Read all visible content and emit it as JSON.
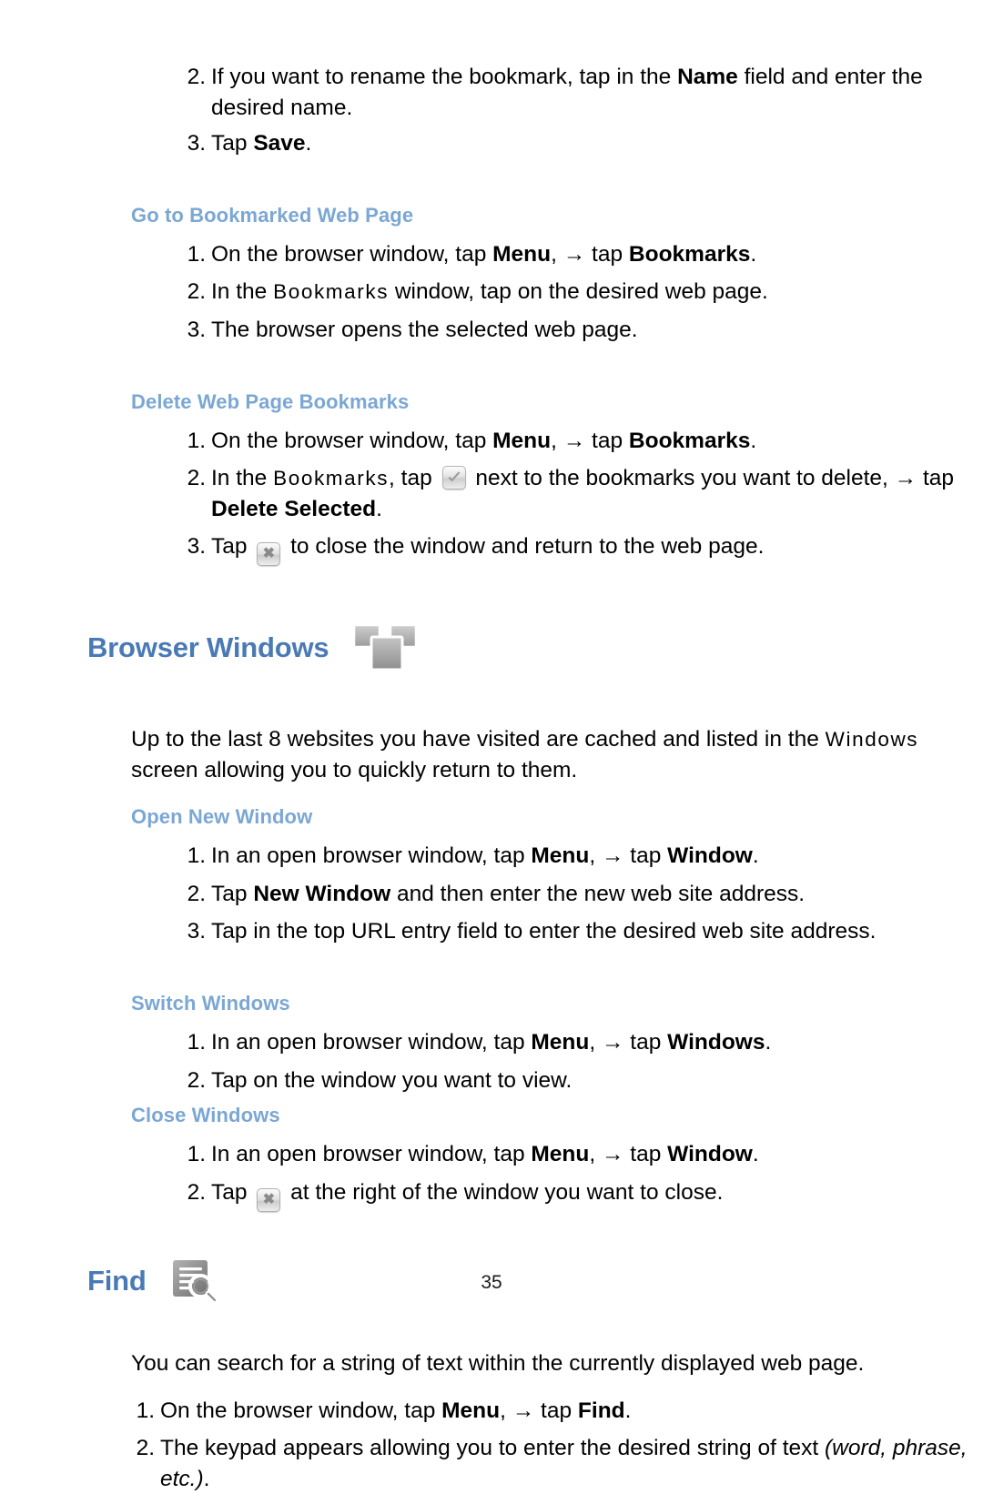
{
  "document": {
    "page_number": "35",
    "colors": {
      "heading_primary": "#4a7ab5",
      "heading_secondary": "#7ba7d4",
      "body_text": "#000000",
      "icon_gray": "#8a8a8a"
    }
  },
  "top_steps": {
    "items": [
      {
        "num": "2.",
        "text_before": "If you want to rename the bookmark, tap in the ",
        "bold": "Name",
        "text_after": " field and enter the desired name."
      },
      {
        "num": "3.",
        "text_before": "Tap ",
        "bold": "Save",
        "text_after": "."
      }
    ]
  },
  "section_goto_bookmarked": {
    "heading": "Go to Bookmarked Web Page",
    "steps": [
      {
        "num": "1.",
        "p1": "On the browser window, tap ",
        "b1": "Menu",
        "p2": ", ",
        "arrow": "→",
        "p3": " tap ",
        "b2": "Bookmarks",
        "p4": "."
      },
      {
        "num": "2.",
        "p1": "In the ",
        "mono": "Bookmarks",
        "p2": " window, tap on the desired web page."
      },
      {
        "num": "3.",
        "p1": "The browser opens the selected web page."
      }
    ]
  },
  "section_delete_bookmarks": {
    "heading": "Delete Web Page Bookmarks",
    "steps": [
      {
        "num": "1.",
        "p1": "On the browser window, tap ",
        "b1": "Menu",
        "p2": ", ",
        "arrow": "→",
        "p3": " tap ",
        "b2": "Bookmarks",
        "p4": "."
      },
      {
        "num": "2.",
        "p1": "In the ",
        "mono": "Bookmarks",
        "p2": ", tap ",
        "icon": "checkbox-icon",
        "p3": " next to the bookmarks you want to delete, ",
        "arrow": "→",
        "p4": " tap ",
        "b1": "Delete Selected",
        "p5": "."
      },
      {
        "num": "3.",
        "p1": "Tap ",
        "icon": "close-icon",
        "p2": " to close the window and return to the web page."
      }
    ]
  },
  "section_browser_windows": {
    "heading": "Browser Windows",
    "icon": "browser-windows-icon",
    "intro": {
      "p1": "Up to the last 8 websites you have visited are cached and listed in the ",
      "mono": "Windows",
      "p2": " screen allowing you to quickly return to them."
    },
    "open_new_window": {
      "heading": "Open New Window",
      "steps": [
        {
          "num": "1.",
          "p1": "In an open browser window, tap ",
          "b1": "Menu",
          "p2": ", ",
          "arrow": "→",
          "p3": " tap ",
          "b2": "Window",
          "p4": "."
        },
        {
          "num": "2.",
          "p1": "Tap ",
          "b1": "New Window",
          "p2": " and then enter the new web site address."
        },
        {
          "num": "3.",
          "p1": "Tap in the top URL entry field to enter the desired web site address."
        }
      ]
    },
    "switch_windows": {
      "heading": "Switch Windows",
      "steps": [
        {
          "num": "1.",
          "p1": "In an open browser window, tap ",
          "b1": "Menu",
          "p2": ", ",
          "arrow": "→",
          "p3": " tap ",
          "b2": "Windows",
          "p4": "."
        },
        {
          "num": "2.",
          "p1": "Tap on the window you want to view."
        }
      ]
    },
    "close_windows": {
      "heading": "Close Windows",
      "steps": [
        {
          "num": "1.",
          "p1": "In an open browser window, tap ",
          "b1": "Menu",
          "p2": ", ",
          "arrow": "→",
          "p3": " tap ",
          "b2": "Window",
          "p4": "."
        },
        {
          "num": "2.",
          "p1": "Tap ",
          "icon": "close-icon",
          "p2": " at the right of the window you want to close."
        }
      ]
    }
  },
  "section_find": {
    "heading": "Find",
    "icon": "find-icon",
    "intro": "You can search for a string of text within the currently displayed web page.",
    "steps": [
      {
        "num": "1.",
        "p1": "On the browser window, tap ",
        "b1": "Menu",
        "p2": ", ",
        "arrow": "→",
        "p3": " tap ",
        "b2": "Find",
        "p4": "."
      },
      {
        "num": "2.",
        "p1": "The keypad appears allowing you to enter the desired string of text ",
        "ital": "(word, phrase, etc.)",
        "p2": "."
      }
    ]
  }
}
